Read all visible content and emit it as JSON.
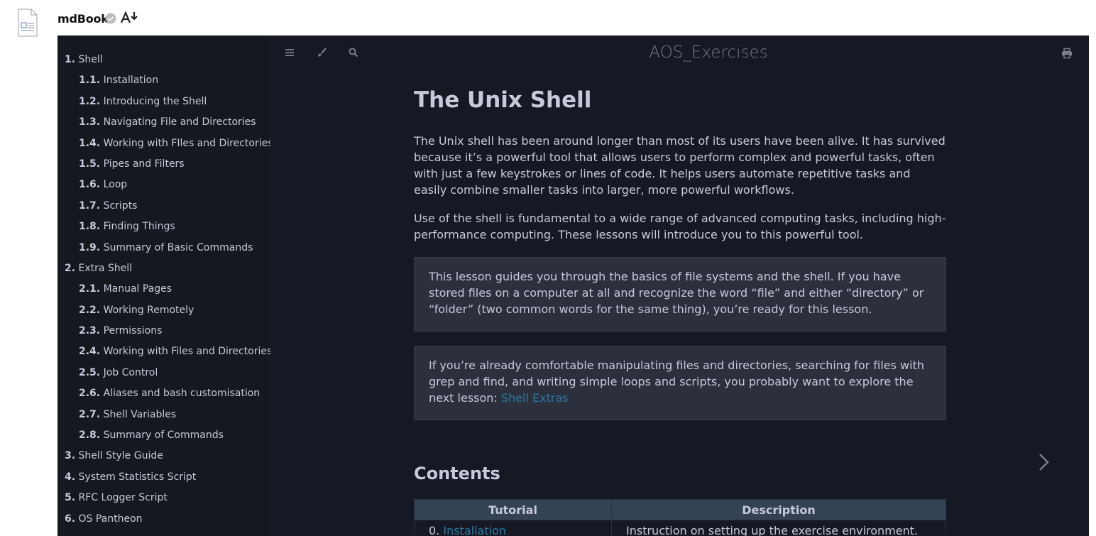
{
  "app": {
    "title": "mdBook",
    "icons": [
      "file-icon",
      "verified-icon",
      "font-download-icon"
    ]
  },
  "book": {
    "title": "AOS_Exercises",
    "toolbar_icons": [
      "menu-icon",
      "theme-brush-icon",
      "search-icon",
      "print-icon"
    ]
  },
  "sidebar": {
    "items": [
      {
        "num": "1.",
        "label": "Shell",
        "level": 1
      },
      {
        "num": "1.1.",
        "label": "Installation",
        "level": 2
      },
      {
        "num": "1.2.",
        "label": "Introducing the Shell",
        "level": 2
      },
      {
        "num": "1.3.",
        "label": "Navigating File and Directories",
        "level": 2
      },
      {
        "num": "1.4.",
        "label": "Working with FIles and Directories",
        "level": 2
      },
      {
        "num": "1.5.",
        "label": "Pipes and Filters",
        "level": 2
      },
      {
        "num": "1.6.",
        "label": "Loop",
        "level": 2
      },
      {
        "num": "1.7.",
        "label": "Scripts",
        "level": 2
      },
      {
        "num": "1.8.",
        "label": "Finding Things",
        "level": 2
      },
      {
        "num": "1.9.",
        "label": "Summary of Basic Commands",
        "level": 2
      },
      {
        "num": "2.",
        "label": "Extra Shell",
        "level": 1
      },
      {
        "num": "2.1.",
        "label": "Manual Pages",
        "level": 2
      },
      {
        "num": "2.2.",
        "label": "Working Remotely",
        "level": 2
      },
      {
        "num": "2.3.",
        "label": "Permissions",
        "level": 2
      },
      {
        "num": "2.4.",
        "label": "Working with Files and Directories",
        "level": 2
      },
      {
        "num": "2.5.",
        "label": "Job Control",
        "level": 2
      },
      {
        "num": "2.6.",
        "label": "Aliases and bash customisation",
        "level": 2
      },
      {
        "num": "2.7.",
        "label": "Shell Variables",
        "level": 2
      },
      {
        "num": "2.8.",
        "label": "Summary of Commands",
        "level": 2
      },
      {
        "num": "3.",
        "label": "Shell Style Guide",
        "level": 1
      },
      {
        "num": "4.",
        "label": "System Statistics Script",
        "level": 1
      },
      {
        "num": "5.",
        "label": "RFC Logger Script",
        "level": 1
      },
      {
        "num": "6.",
        "label": "OS Pantheon",
        "level": 1
      }
    ]
  },
  "page": {
    "heading": "The Unix Shell",
    "para1": "The Unix shell has been around longer than most of its users have been alive. It has survived because it’s a powerful tool that allows users to perform complex and powerful tasks, often with just a few keystrokes or lines of code. It helps users automate repetitive tasks and easily combine smaller tasks into larger, more powerful workflows.",
    "para2": "Use of the shell is fundamental to a wide range of advanced computing tasks, including high-performance computing. These lessons will introduce you to this powerful tool.",
    "note1": "This lesson guides you through the basics of file systems and the shell. If you have stored files on a computer at all and recognize the word “file” and either “directory” or “folder” (two common words for the same thing), you’re ready for this lesson.",
    "note2_text": "If you’re already comfortable manipulating files and directories, searching for files with grep and find, and writing simple loops and scripts, you probably want to explore the next lesson: ",
    "note2_link": "Shell Extras",
    "contents_heading": "Contents",
    "table": {
      "headers": [
        "Tutorial",
        "Description"
      ],
      "rows": [
        {
          "num": "0.",
          "link": "Installation",
          "desc": "Instruction on setting up the exercise environment."
        }
      ]
    }
  },
  "nav": {
    "next_icon": "chevron-right-icon"
  },
  "colors": {
    "background": "#161923",
    "sidebar": "#14191f",
    "text": "#c8c9db",
    "link": "#2b79a2",
    "table_header": "#344354",
    "note": "#2c2f3c"
  }
}
